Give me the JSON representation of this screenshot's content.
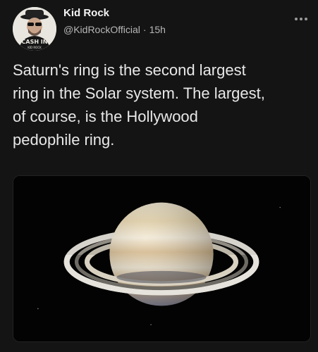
{
  "tweet": {
    "author": {
      "display_name": "Kid Rock",
      "handle": "@KidRockOfficial",
      "avatar_text": "CASH IN",
      "avatar_subtext": "KID ROCK"
    },
    "timestamp": "15h",
    "separator": "·",
    "text": "Saturn's ring is the second largest\nring in the Solar system. The largest,\nof course, is the Hollywood\npedophile ring.",
    "media": {
      "icon": "saturn-image"
    }
  },
  "colors": {
    "background": "#141414",
    "primary_text": "#e8e8e8",
    "secondary_text": "#b7b7b7"
  }
}
